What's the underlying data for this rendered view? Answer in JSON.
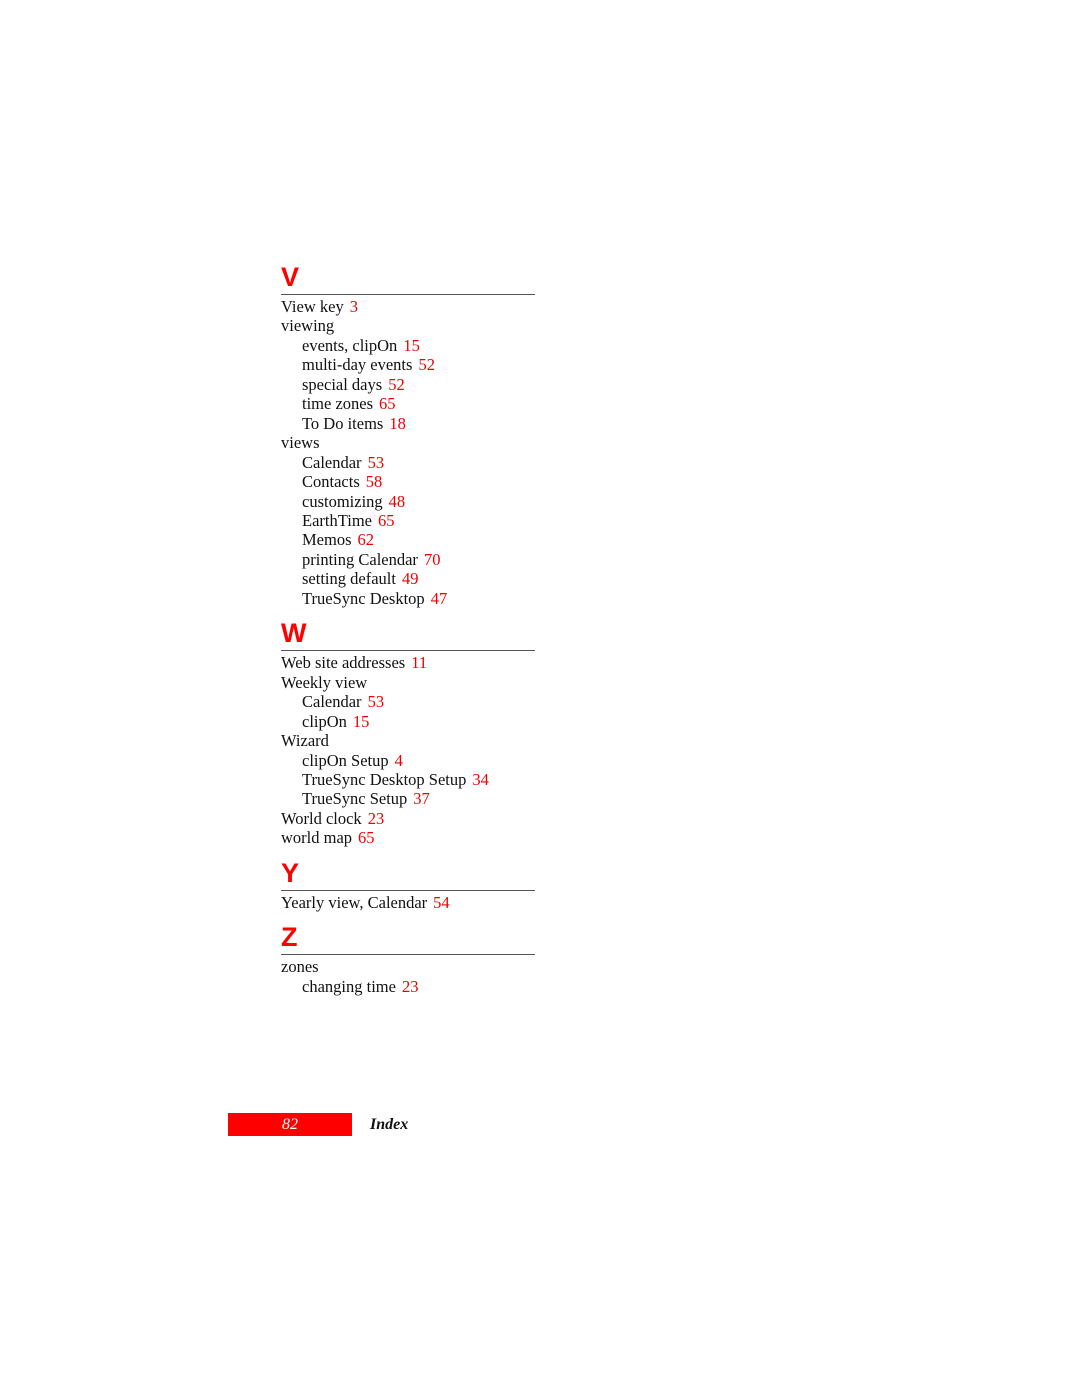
{
  "sections": [
    {
      "letter": "V",
      "entries": [
        {
          "text": "View key",
          "page": "3",
          "level": 0
        },
        {
          "text": "viewing",
          "page": "",
          "level": 0
        },
        {
          "text": "events, clipOn",
          "page": "15",
          "level": 1
        },
        {
          "text": "multi-day events",
          "page": "52",
          "level": 1
        },
        {
          "text": "special days",
          "page": "52",
          "level": 1
        },
        {
          "text": "time zones",
          "page": "65",
          "level": 1
        },
        {
          "text": "To Do items",
          "page": "18",
          "level": 1
        },
        {
          "text": "views",
          "page": "",
          "level": 0
        },
        {
          "text": "Calendar",
          "page": "53",
          "level": 1
        },
        {
          "text": "Contacts",
          "page": "58",
          "level": 1
        },
        {
          "text": "customizing",
          "page": "48",
          "level": 1
        },
        {
          "text": "EarthTime",
          "page": "65",
          "level": 1
        },
        {
          "text": "Memos",
          "page": "62",
          "level": 1
        },
        {
          "text": "printing Calendar",
          "page": "70",
          "level": 1
        },
        {
          "text": "setting default",
          "page": "49",
          "level": 1
        },
        {
          "text": "TrueSync Desktop",
          "page": "47",
          "level": 1
        }
      ]
    },
    {
      "letter": "W",
      "entries": [
        {
          "text": "Web site addresses",
          "page": "11",
          "level": 0
        },
        {
          "text": "Weekly view",
          "page": "",
          "level": 0
        },
        {
          "text": "Calendar",
          "page": "53",
          "level": 1
        },
        {
          "text": "clipOn",
          "page": "15",
          "level": 1
        },
        {
          "text": "Wizard",
          "page": "",
          "level": 0
        },
        {
          "text": "clipOn Setup",
          "page": "4",
          "level": 1
        },
        {
          "text": "TrueSync Desktop Setup",
          "page": "34",
          "level": 1
        },
        {
          "text": "TrueSync Setup",
          "page": "37",
          "level": 1
        },
        {
          "text": "World clock",
          "page": "23",
          "level": 0
        },
        {
          "text": "world map",
          "page": "65",
          "level": 0
        }
      ]
    },
    {
      "letter": "Y",
      "entries": [
        {
          "text": "Yearly view, Calendar",
          "page": "54",
          "level": 0
        }
      ]
    },
    {
      "letter": "Z",
      "entries": [
        {
          "text": "zones",
          "page": "",
          "level": 0
        },
        {
          "text": "changing time",
          "page": "23",
          "level": 1
        }
      ]
    }
  ],
  "footer": {
    "page_number": "82",
    "title": "Index"
  },
  "colors": {
    "accent": "#ff0000",
    "page_ref": "#ee0000",
    "text": "#111111"
  }
}
